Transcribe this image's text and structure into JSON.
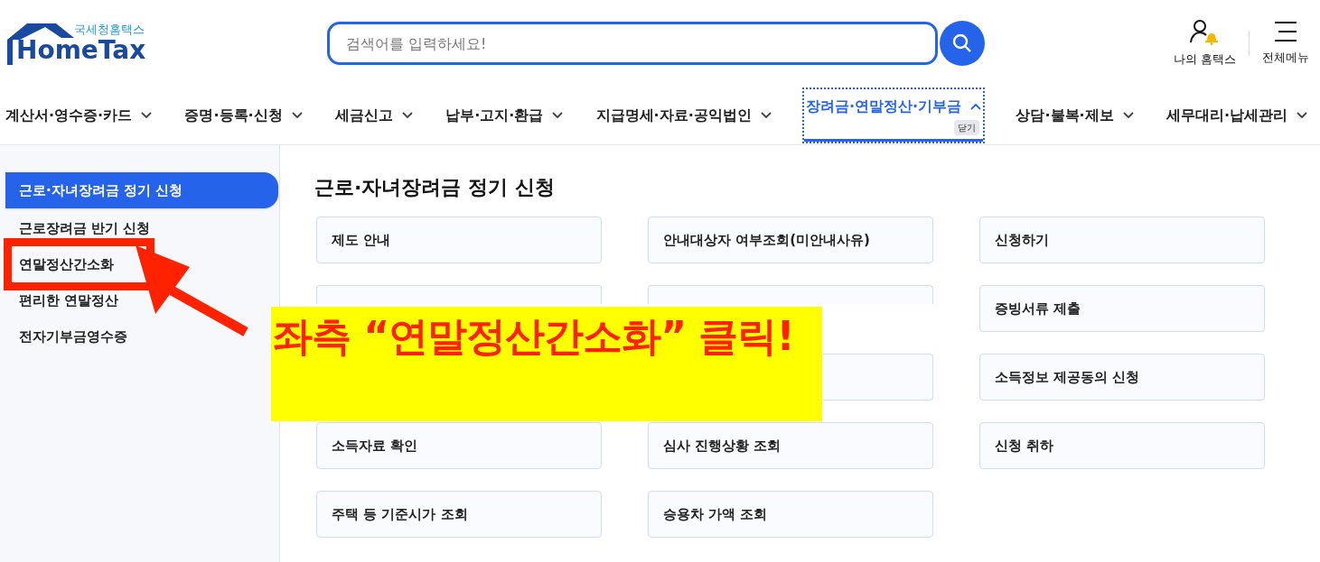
{
  "header": {
    "logo": {
      "subtitle": "국세청홈택스",
      "name": "HomeTax"
    },
    "search": {
      "placeholder": "검색어를 입력하세요!"
    },
    "utilities": [
      {
        "kind": "user",
        "label": "나의 홈택스"
      },
      {
        "kind": "menu",
        "label": "전체메뉴"
      }
    ]
  },
  "nav": {
    "close_tip": "닫기",
    "items": [
      {
        "label": "계산서·영수증·카드",
        "selected": false
      },
      {
        "label": "증명·등록·신청",
        "selected": false
      },
      {
        "label": "세금신고",
        "selected": false
      },
      {
        "label": "납부·고지·환급",
        "selected": false
      },
      {
        "label": "지급명세·자료·공익법인",
        "selected": false
      },
      {
        "label": "장려금·연말정산·기부금",
        "selected": true
      },
      {
        "label": "상담·불복·제보",
        "selected": false
      },
      {
        "label": "세무대리·납세관리",
        "selected": false
      }
    ]
  },
  "sidebar": {
    "items": [
      {
        "label": "근로·자녀장려금 정기 신청",
        "selected": true
      },
      {
        "label": "근로장려금 반기 신청",
        "selected": false
      },
      {
        "label": "연말정산간소화",
        "selected": false
      },
      {
        "label": "편리한 연말정산",
        "selected": false
      },
      {
        "label": "전자기부금영수증",
        "selected": false
      }
    ]
  },
  "content": {
    "title": "근로·자녀장려금 정기 신청",
    "cards": [
      {
        "label": "제도 안내"
      },
      {
        "label": "안내대상자 여부조회(미안내사유)"
      },
      {
        "label": "신청하기"
      },
      {
        "kind": "top_visible"
      },
      {
        "kind": "top_visible"
      },
      {
        "label": "증빙서류 제출"
      },
      {
        "kind": "hidden"
      },
      {
        "kind": "right_visible"
      },
      {
        "label": "소득정보 제공동의 신청"
      },
      {
        "label": "소득자료 확인"
      },
      {
        "label": "심사 진행상황 조회"
      },
      {
        "label": "신청 취하"
      },
      {
        "label": "주택 등 기준시가 조회"
      },
      {
        "label": "승용차 가액 조회"
      }
    ]
  },
  "annotation": {
    "text": "좌측 “연말정산간소화” 클릭!"
  }
}
